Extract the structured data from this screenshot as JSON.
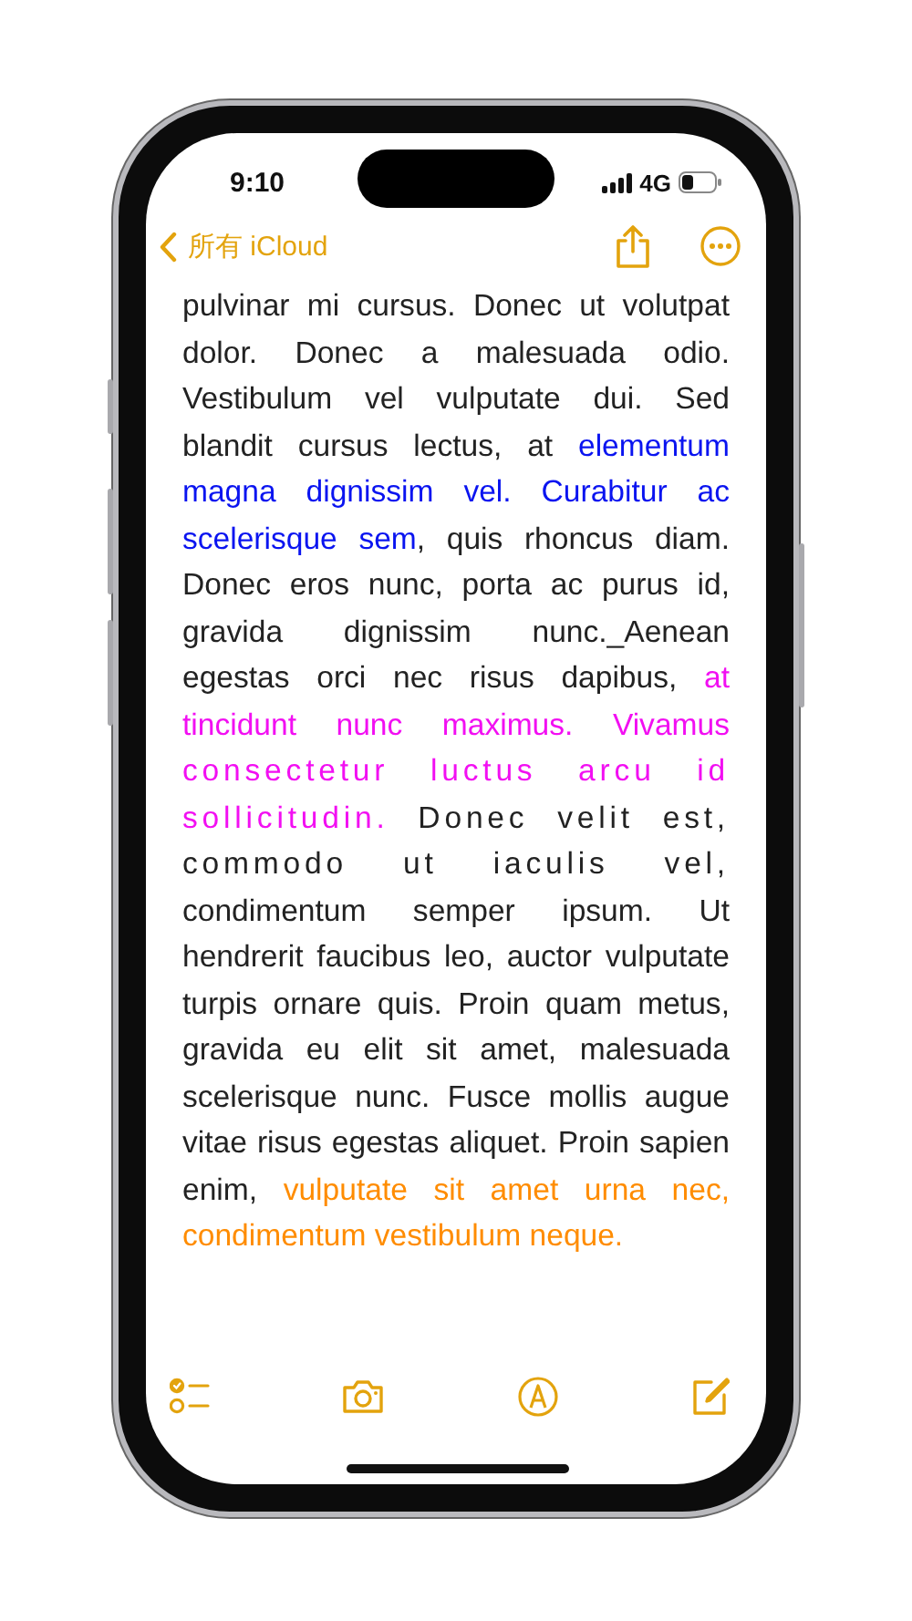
{
  "status_bar": {
    "time": "9:10",
    "network": "4G"
  },
  "nav": {
    "back": "所有 iCloud"
  },
  "note": {
    "segments": [
      {
        "text": "pulvinar mi cursus. Donec ut volutpat dolor. Donec a malesuada odio. Vestibulum vel vulputate dui. Sed blandit cursus lectus, at ",
        "color": "#222222",
        "spaced": false
      },
      {
        "text": "elementum magna dignissim vel. Curabitur ac scelerisque sem",
        "color": "#0a14f0",
        "spaced": false
      },
      {
        "text": ", quis rhoncus diam. Donec eros nunc, porta ac purus id, gravida dignissim nunc._Aenean egestas orci nec risus dapibus, ",
        "color": "#222222",
        "spaced": false
      },
      {
        "text": "at tincidunt nunc maximus. Vivamus ",
        "color": "#f20ff2",
        "spaced": false
      },
      {
        "text": "consectetur luctus arcu id sollicitudin.",
        "color": "#f20ff2",
        "spaced": true
      },
      {
        "text": " Donec velit est, commodo ut iaculis vel,",
        "color": "#222222",
        "spaced": true
      },
      {
        "text": " condimentum semper ipsum. Ut hendrerit faucibus leo, auctor vulputate turpis ornare quis. Proin quam metus, gravida eu elit sit amet, malesuada scelerisque nunc. Fusce mollis augue vitae risus egestas aliquet. Proin sapien enim, ",
        "color": "#222222",
        "spaced": false
      },
      {
        "text": "vulputate sit amet urna nec, condimentum vestibulum neque.",
        "color": "#ff8c00",
        "spaced": false
      }
    ]
  }
}
